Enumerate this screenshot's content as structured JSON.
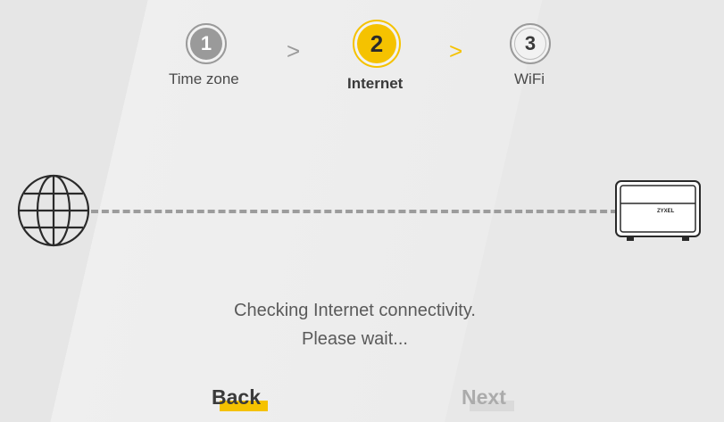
{
  "steps": [
    {
      "number": "1",
      "label": "Time zone",
      "state": "completed"
    },
    {
      "number": "2",
      "label": "Internet",
      "state": "active"
    },
    {
      "number": "3",
      "label": "WiFi",
      "state": "pending"
    }
  ],
  "separators": [
    ">",
    ">"
  ],
  "status": {
    "line1": "Checking Internet connectivity.",
    "line2": "Please wait..."
  },
  "router_brand": "ZYXEL",
  "buttons": {
    "back": "Back",
    "next": "Next"
  },
  "colors": {
    "accent": "#f5c200",
    "inactive": "#9a9a9a",
    "text": "#4a4a4a",
    "line": "#9c9c9c"
  },
  "icons": {
    "globe": "globe-icon",
    "router": "router-icon"
  }
}
